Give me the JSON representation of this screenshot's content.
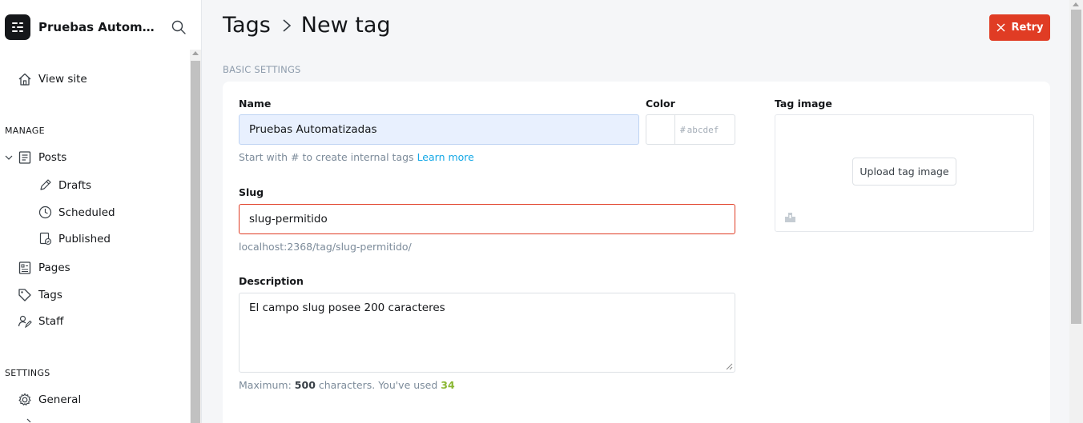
{
  "sidebar": {
    "site_title": "Pruebas Automatizadas",
    "view_site": "View site",
    "manage_label": "MANAGE",
    "posts": "Posts",
    "drafts": "Drafts",
    "scheduled": "Scheduled",
    "published": "Published",
    "pages": "Pages",
    "tags": "Tags",
    "staff": "Staff",
    "settings_label": "SETTINGS",
    "general": "General"
  },
  "header": {
    "crumb_parent": "Tags",
    "crumb_current": "New tag",
    "retry_label": "Retry"
  },
  "form": {
    "section_label": "BASIC SETTINGS",
    "name_label": "Name",
    "name_value": "Pruebas Automatizadas",
    "name_hint": "Start with # to create internal tags",
    "learn_more": "Learn more",
    "color_label": "Color",
    "color_placeholder": "abcdef",
    "color_hash": "#",
    "slug_label": "Slug",
    "slug_value": "slug-permitido",
    "slug_url": "localhost:2368/tag/slug-permitido/",
    "description_label": "Description",
    "description_value": "El campo slug posee 200 caracteres",
    "max_prefix": "Maximum:",
    "max_value": "500",
    "max_mid": "characters. You've used",
    "used_value": "34",
    "tag_image_label": "Tag image",
    "upload_label": "Upload tag image"
  },
  "colors": {
    "accent": "#e03c24",
    "link": "#14a8e6",
    "count_ok": "#8ab733"
  }
}
